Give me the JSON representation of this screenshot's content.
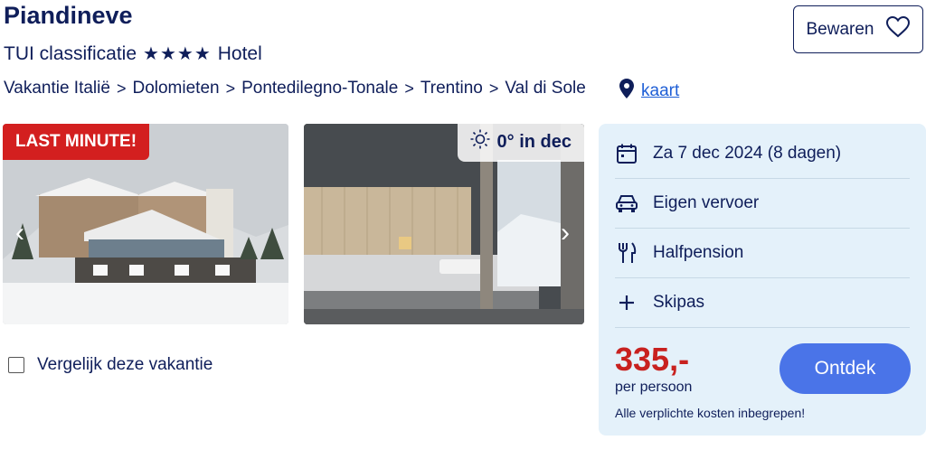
{
  "hotel": {
    "name": "Piandineve",
    "classification_label": "TUI classificatie",
    "stars": "★★★★",
    "type": "Hotel"
  },
  "breadcrumb": [
    "Vakantie Italië",
    "Dolomieten",
    "Pontedilegno-Tonale",
    "Trentino",
    "Val di Sole"
  ],
  "breadcrumb_separator": ">",
  "map_link": "kaart",
  "save_button": "Bewaren",
  "images": {
    "badge": "LAST MINUTE!",
    "weather": "0° in dec"
  },
  "compare_label": "Vergelijk deze vakantie",
  "details": [
    {
      "icon": "calendar-icon",
      "label": "Za 7 dec 2024 (8 dagen)"
    },
    {
      "icon": "car-icon",
      "label": "Eigen vervoer"
    },
    {
      "icon": "fork-knife-icon",
      "label": "Halfpension"
    },
    {
      "icon": "plus-icon",
      "label": "Skipas"
    }
  ],
  "price": {
    "amount": "335,-",
    "per": "per persoon",
    "note": "Alle verplichte kosten inbegrepen!"
  },
  "cta": "Ontdek",
  "colors": {
    "brand_navy": "#0f1e5a",
    "price_red": "#c8211f",
    "cta_blue": "#4a74e8",
    "panel_bg": "#e4f1fa",
    "badge_red": "#d31f1f"
  }
}
